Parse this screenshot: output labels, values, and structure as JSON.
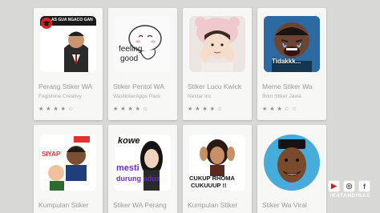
{
  "apps": [
    {
      "title": "Perang Stiker WA",
      "developer": "Fagishine Creativy",
      "stars": "★ ★ ★ ★ ☆",
      "thumb_text": "AS GUA NGACO GAN",
      "icon": "graduation-cap-icon"
    },
    {
      "title": "Stiker Pentol WA",
      "developer": "WastickerApps Pack",
      "stars": "★ ★ ★ ★ ☆",
      "thumb_text_1": "feeling",
      "thumb_text_2": "good"
    },
    {
      "title": "Stiker Lucu Kwick",
      "developer": "Nextar Inc",
      "stars": "★ ★ ★ ★ ☆"
    },
    {
      "title": "Meme Stiker Wa",
      "developer": "Bom Stiker Jawa",
      "stars": "★ ★ ★ ☆ ☆",
      "thumb_text": "Tidakkk..."
    },
    {
      "title": "Kumpulan Stiker",
      "thumb_text": "SIYAP"
    },
    {
      "title": "Stiker WA Perang",
      "thumb_text_1": "kowe",
      "thumb_text_2": "mesti",
      "thumb_text_3": "durung adus"
    },
    {
      "title": "Kumpulan Stiker",
      "thumb_text_1": "CUKUP RHOMA",
      "thumb_text_2": "CUKUUUP !!"
    },
    {
      "title": "Stiker Wa Viral"
    }
  ],
  "brand": {
    "name": "IKATANDINAS",
    "youtube": "▶",
    "instagram": "◎",
    "facebook": "f"
  }
}
